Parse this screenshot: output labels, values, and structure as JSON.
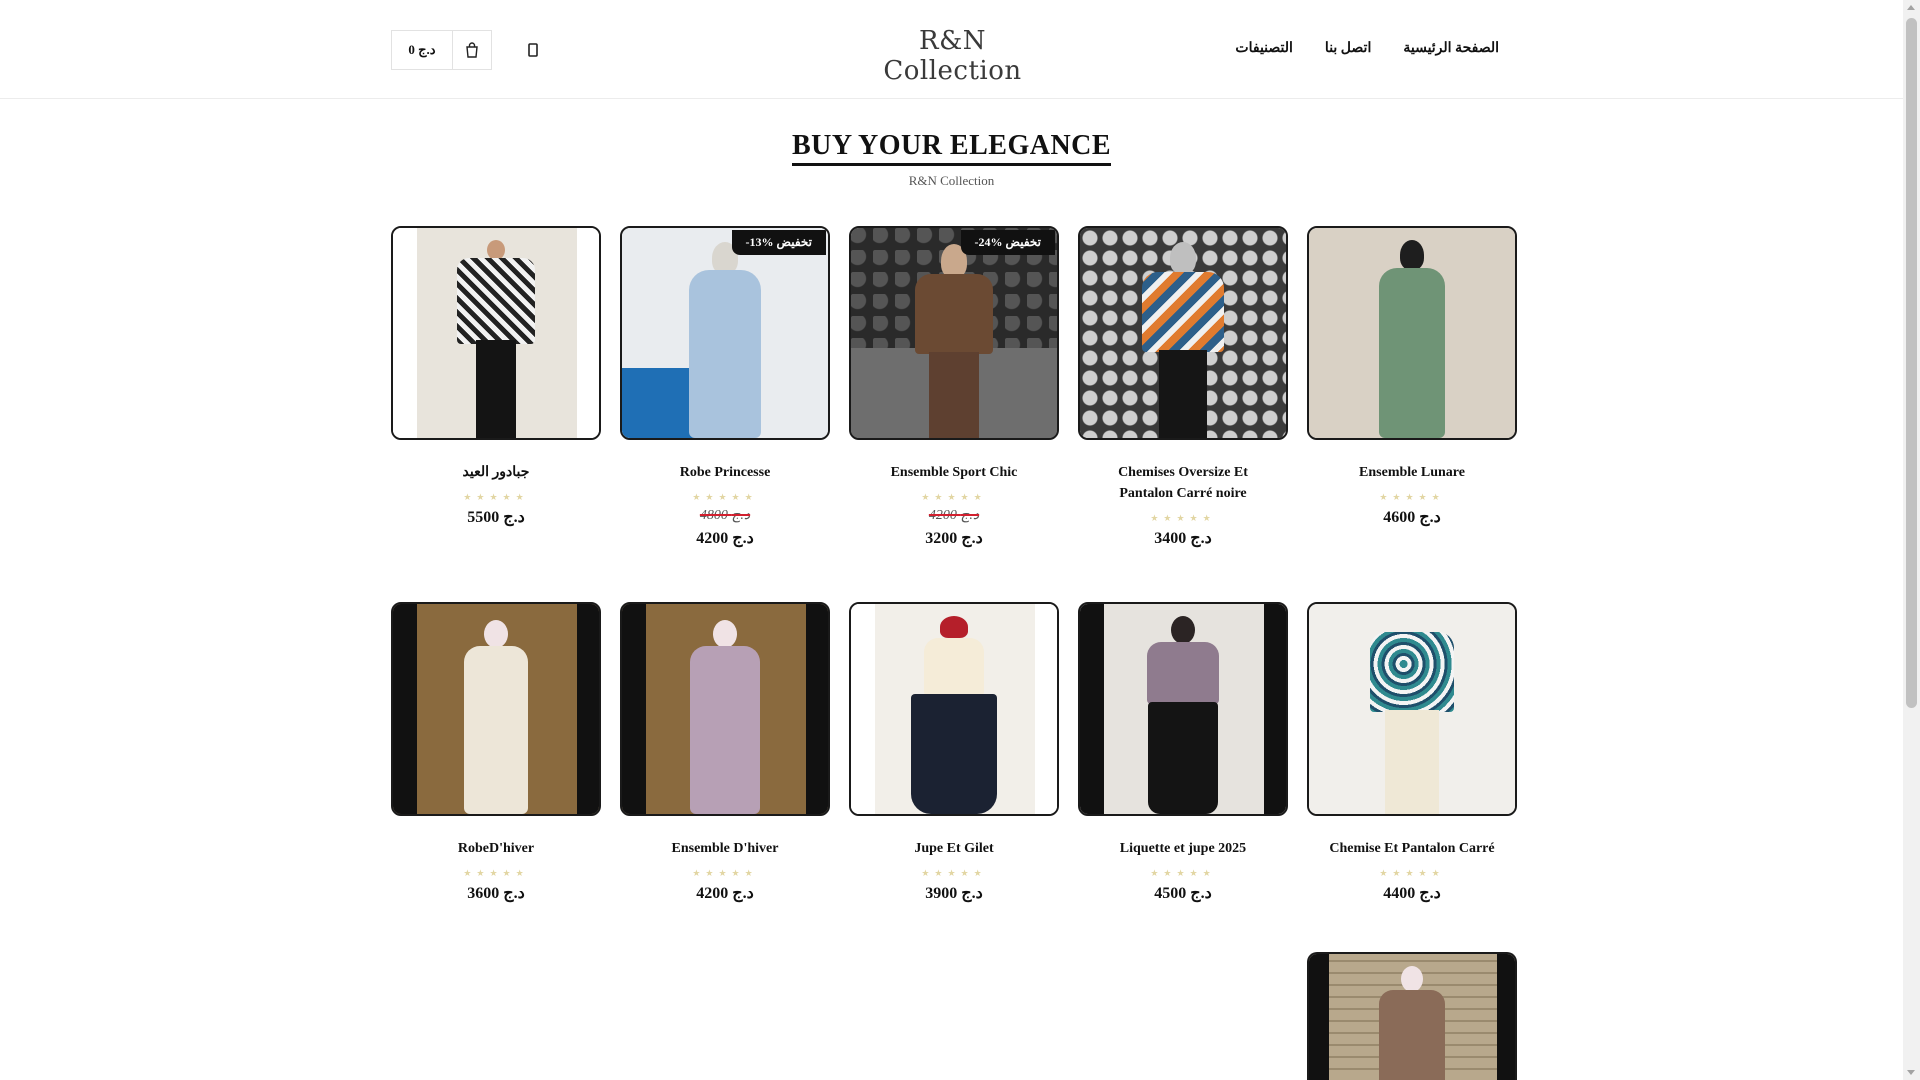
{
  "header": {
    "cart_total": "0 د.ج",
    "logo_text": "R&N Collection",
    "nav": [
      "الصفحة الرئيسية",
      "اتصل بنا",
      "التصنيفات"
    ]
  },
  "hero": {
    "title": "BUY YOUR ELEGANCE",
    "subtitle": "R&N Collection"
  },
  "products": [
    {
      "name": "جبادور العيد",
      "old_price": "",
      "price": "5500 د.ج",
      "badge": ""
    },
    {
      "name": "Robe Princesse",
      "old_price": "4800 د.ج",
      "price": "4200 د.ج",
      "badge": "تخفيض %13-"
    },
    {
      "name": "Ensemble Sport Chic",
      "old_price": "4200 د.ج",
      "price": "3200 د.ج",
      "badge": "تخفيض %24-"
    },
    {
      "name": "Chemises Oversize Et Pantalon Carré noire",
      "old_price": "",
      "price": "3400 د.ج",
      "badge": ""
    },
    {
      "name": "Ensemble Lunare",
      "old_price": "",
      "price": "4600 د.ج",
      "badge": ""
    },
    {
      "name": "RobeD'hiver",
      "old_price": "",
      "price": "3600 د.ج",
      "badge": ""
    },
    {
      "name": "Ensemble D'hiver",
      "old_price": "",
      "price": "4200 د.ج",
      "badge": ""
    },
    {
      "name": "Jupe Et Gilet",
      "old_price": "",
      "price": "3900 د.ج",
      "badge": ""
    },
    {
      "name": "Liquette et jupe 2025",
      "old_price": "",
      "price": "4500 د.ج",
      "badge": ""
    },
    {
      "name": "Chemise Et Pantalon Carré",
      "old_price": "",
      "price": "4400 د.ج",
      "badge": ""
    }
  ],
  "rating_stars": "★★★★★",
  "colors": {
    "border": "#1a1a1a",
    "badge_bg": "#111111",
    "strike": "#d2202f",
    "stars": "#e2d6a3"
  }
}
